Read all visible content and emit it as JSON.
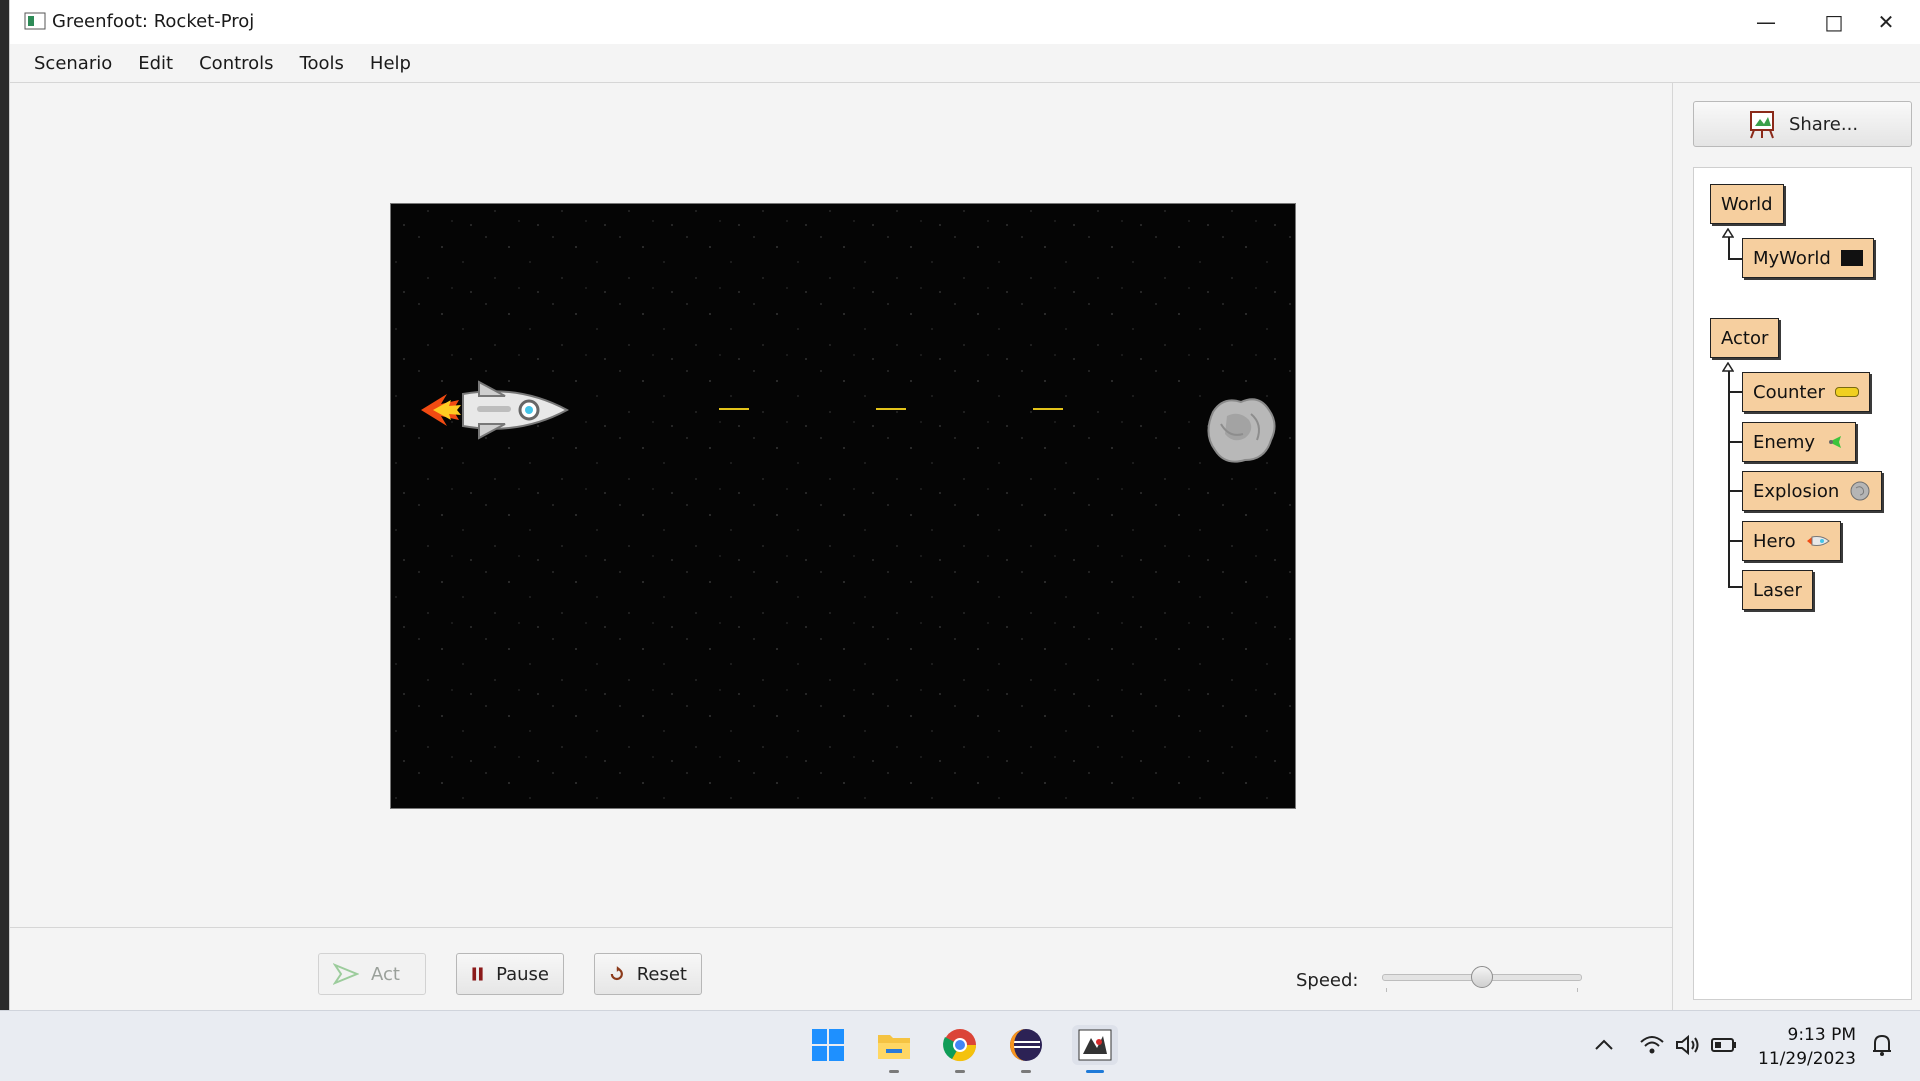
{
  "window": {
    "title": "Greenfoot: Rocket-Proj",
    "minimize_glyph": "—",
    "maximize_glyph": "□",
    "close_glyph": "✕"
  },
  "menu": {
    "items": [
      "Scenario",
      "Edit",
      "Controls",
      "Tools",
      "Help"
    ]
  },
  "controls": {
    "act_label": "Act",
    "pause_label": "Pause",
    "reset_label": "Reset",
    "speed_label": "Speed:",
    "speed_value_fraction": 0.5
  },
  "side": {
    "share_label": "Share...",
    "classes": {
      "world_root": "World",
      "world_children": [
        "MyWorld"
      ],
      "actor_root": "Actor",
      "actor_children": [
        "Counter",
        "Enemy",
        "Explosion",
        "Hero",
        "Laser"
      ]
    }
  },
  "world": {
    "background": "starfield",
    "actors": [
      "hero-rocket",
      "laser",
      "laser",
      "laser",
      "enemy-asteroid"
    ]
  },
  "taskbar": {
    "icons": [
      "windows-start-icon",
      "file-explorer-icon",
      "chrome-icon",
      "eclipse-icon",
      "greenfoot-icon"
    ],
    "tray_icons": [
      "chevron-up-icon",
      "wifi-icon",
      "volume-icon",
      "battery-icon",
      "notification-icon"
    ],
    "time": "9:13 PM",
    "date": "11/29/2023"
  },
  "colors": {
    "class_box": "#f6cf9f",
    "laser": "#e3c31a",
    "canvas": "#050505"
  }
}
